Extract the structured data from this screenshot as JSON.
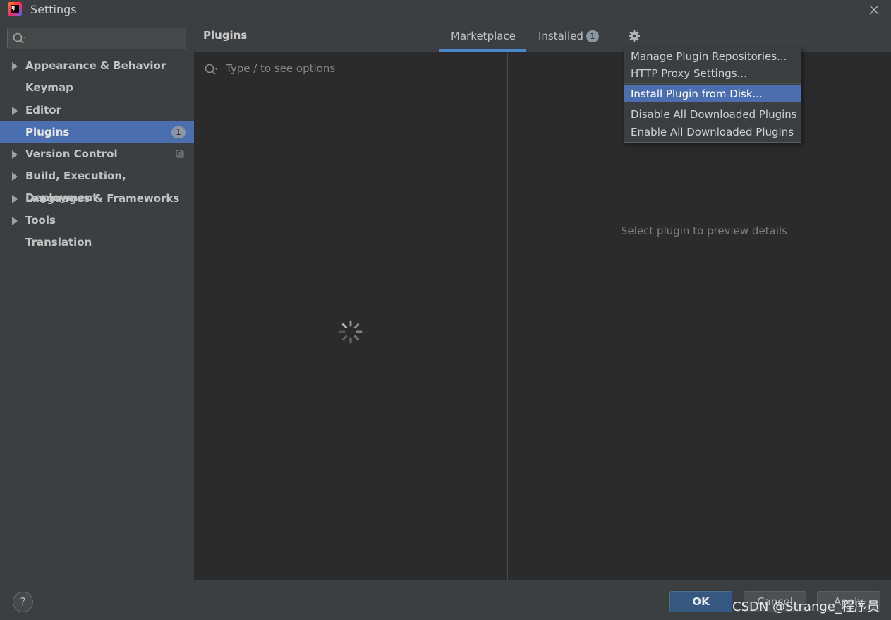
{
  "window": {
    "title": "Settings",
    "app_icon_text": "IJ"
  },
  "sidebar": {
    "search_placeholder": "",
    "items": [
      {
        "label": "Appearance & Behavior",
        "expandable": true
      },
      {
        "label": "Keymap",
        "expandable": false
      },
      {
        "label": "Editor",
        "expandable": true
      },
      {
        "label": "Plugins",
        "expandable": false,
        "selected": true,
        "badge": "1"
      },
      {
        "label": "Version Control",
        "expandable": true
      },
      {
        "label": "Build, Execution, Deployment",
        "expandable": true
      },
      {
        "label": "Languages & Frameworks",
        "expandable": true
      },
      {
        "label": "Tools",
        "expandable": true
      },
      {
        "label": "Translation",
        "expandable": false
      }
    ]
  },
  "plugins": {
    "title": "Plugins",
    "tabs": [
      {
        "label": "Marketplace",
        "active": true
      },
      {
        "label": "Installed",
        "badge": "1"
      }
    ],
    "search_placeholder": "Type / to see options",
    "details_hint": "Select plugin to preview details"
  },
  "gear_menu": {
    "items": [
      {
        "label": "Manage Plugin Repositories..."
      },
      {
        "label": "HTTP Proxy Settings..."
      },
      {
        "label": "Install Plugin from Disk...",
        "highlighted": true
      },
      {
        "label": "Disable All Downloaded Plugins"
      },
      {
        "label": "Enable All Downloaded Plugins"
      }
    ]
  },
  "buttons": {
    "help": "?",
    "ok": "OK",
    "cancel": "Cancel",
    "apply": "Apply"
  },
  "watermark": "CSDN @Strange_程序员",
  "colors": {
    "accent": "#4b6eaf",
    "tab_underline": "#4a88c7",
    "highlight_frame": "#e02020",
    "ok_button": "#365880"
  }
}
